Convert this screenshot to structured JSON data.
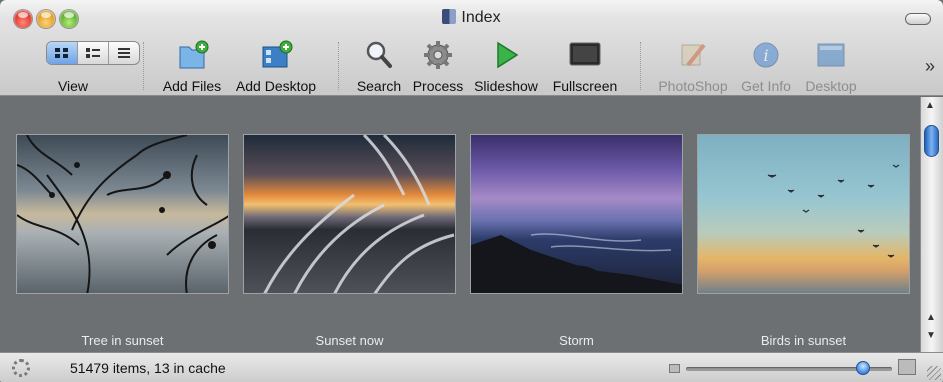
{
  "window": {
    "title": "Index"
  },
  "toolbar": {
    "view_label": "View",
    "view_modes": [
      "grid-view",
      "list-detail-view",
      "list-view"
    ],
    "items": [
      {
        "label": "Add Files",
        "icon": "add-files-icon",
        "enabled": true
      },
      {
        "label": "Add Desktop",
        "icon": "add-desktop-icon",
        "enabled": true
      },
      {
        "label": "Search",
        "icon": "magnifier-icon",
        "enabled": true
      },
      {
        "label": "Process",
        "icon": "gear-icon",
        "enabled": true
      },
      {
        "label": "Slideshow",
        "icon": "play-icon",
        "enabled": true
      },
      {
        "label": "Fullscreen",
        "icon": "monitor-icon",
        "enabled": true
      },
      {
        "label": "PhotoShop",
        "icon": "brush-icon",
        "enabled": false
      },
      {
        "label": "Get Info",
        "icon": "info-icon",
        "enabled": false
      },
      {
        "label": "Desktop",
        "icon": "desktop-icon",
        "enabled": false
      }
    ],
    "overflow": "»"
  },
  "photos": [
    {
      "caption": "Tree in sunset"
    },
    {
      "caption": "Sunset now"
    },
    {
      "caption": "Storm"
    },
    {
      "caption": "Birds in sunset"
    }
  ],
  "status": {
    "text": "51479 items, 13 in cache"
  },
  "colors": {
    "selection_blue": "#6fa3e6",
    "content_bg": "#6c7073",
    "caption_text": "#e9ecee"
  }
}
